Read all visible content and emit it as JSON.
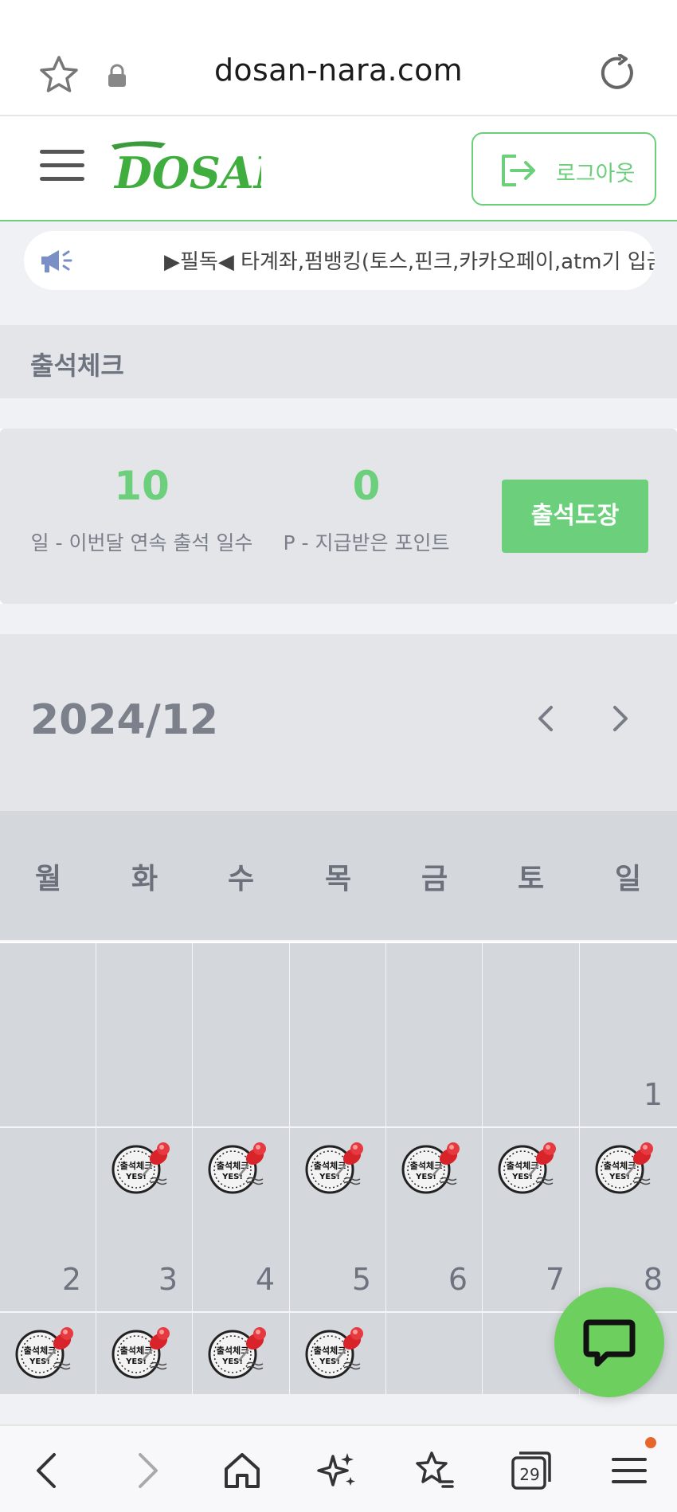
{
  "browser": {
    "url": "dosan-nara.com",
    "tab_count": "29"
  },
  "header": {
    "logo_text": "DOSAN",
    "logout_label": "로그아웃"
  },
  "notice": {
    "text": "▶필독◀ 타계좌,펌뱅킹(토스,핀크,카카오페이,atm기 입금"
  },
  "page": {
    "title": "출석체크"
  },
  "stats": {
    "days_value": "10",
    "days_label": "일 - 이번달 연속 출석 일수",
    "points_value": "0",
    "points_label": "P - 지급받은 포인트",
    "stamp_button": "출석도장"
  },
  "calendar": {
    "year_month": "2024/12",
    "weekdays": [
      "월",
      "화",
      "수",
      "목",
      "금",
      "토",
      "일"
    ],
    "rows": [
      [
        {
          "day": "",
          "stamp": false
        },
        {
          "day": "",
          "stamp": false
        },
        {
          "day": "",
          "stamp": false
        },
        {
          "day": "",
          "stamp": false
        },
        {
          "day": "",
          "stamp": false
        },
        {
          "day": "",
          "stamp": false
        },
        {
          "day": "1",
          "stamp": false
        }
      ],
      [
        {
          "day": "2",
          "stamp": false
        },
        {
          "day": "3",
          "stamp": true
        },
        {
          "day": "4",
          "stamp": true
        },
        {
          "day": "5",
          "stamp": true
        },
        {
          "day": "6",
          "stamp": true
        },
        {
          "day": "7",
          "stamp": true
        },
        {
          "day": "8",
          "stamp": true
        }
      ],
      [
        {
          "day": "",
          "stamp": true
        },
        {
          "day": "",
          "stamp": true
        },
        {
          "day": "",
          "stamp": true
        },
        {
          "day": "",
          "stamp": true
        },
        {
          "day": "",
          "stamp": false
        },
        {
          "day": "",
          "stamp": false
        },
        {
          "day": "",
          "stamp": false
        }
      ]
    ],
    "stamp_text_top": "출석체크",
    "stamp_text_bottom": "YES!"
  },
  "colors": {
    "accent": "#6ccf7b",
    "panel": "#e3e5e9",
    "cell": "#d4d7dc",
    "chat": "#6ccf5e"
  }
}
